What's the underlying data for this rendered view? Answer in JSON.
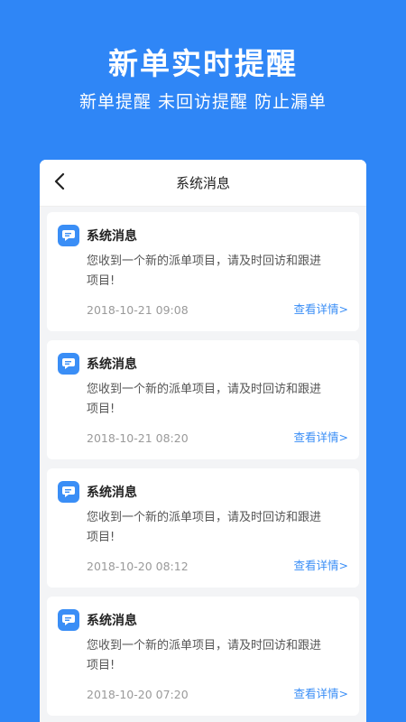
{
  "hero": {
    "title": "新单实时提醒",
    "subtitle": "新单提醒  未回访提醒  防止漏单"
  },
  "header": {
    "title": "系统消息"
  },
  "messages": [
    {
      "title": "系统消息",
      "body": "您收到一个新的派单项目，请及时回访和跟进项目!",
      "time": "2018-10-21 09:08",
      "link": "查看详情>"
    },
    {
      "title": "系统消息",
      "body": "您收到一个新的派单项目，请及时回访和跟进项目!",
      "time": "2018-10-21 08:20",
      "link": "查看详情>"
    },
    {
      "title": "系统消息",
      "body": "您收到一个新的派单项目，请及时回访和跟进项目!",
      "time": "2018-10-20 08:12",
      "link": "查看详情>"
    },
    {
      "title": "系统消息",
      "body": "您收到一个新的派单项目，请及时回访和跟进项目!",
      "time": "2018-10-20 07:20",
      "link": "查看详情>"
    }
  ],
  "colors": {
    "background": "#2f86f6",
    "accent": "#3a8ef6",
    "card": "#ffffff"
  },
  "icons": {
    "back": "chevron-left-icon",
    "message": "chat-bubble-icon"
  }
}
